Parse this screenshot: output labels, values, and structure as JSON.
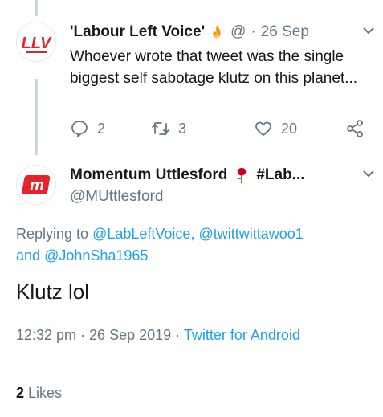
{
  "tweet1": {
    "name": "'Labour Left Voice'",
    "handle": "@",
    "separator": "·",
    "time": "26 Sep",
    "text": "Whoever wrote that tweet was the single biggest self sabotage klutz on this planet...",
    "replies": "2",
    "retweets": "3",
    "likes": "20",
    "avatar_text": "LLV"
  },
  "tweet2": {
    "name": "Momentum Uttlesford",
    "name_suffix": "#Lab...",
    "handle": "@MUttlesford",
    "replying_prefix": "Replying to",
    "mention1": "@LabLeftVoice,",
    "mention2": "@twittwittawoo1",
    "and_text": "and",
    "mention3": "@JohnSha1965",
    "text": "Klutz lol",
    "timestamp": "12:32 pm · 26 Sep 2019 ·",
    "client": "Twitter for Android",
    "likes_count": "2",
    "likes_label": "Likes",
    "avatar_text": "m"
  },
  "colors": {
    "accent": "#1da1f2",
    "muted": "#657786",
    "text": "#14171a",
    "momentum_red": "#e4232b"
  }
}
